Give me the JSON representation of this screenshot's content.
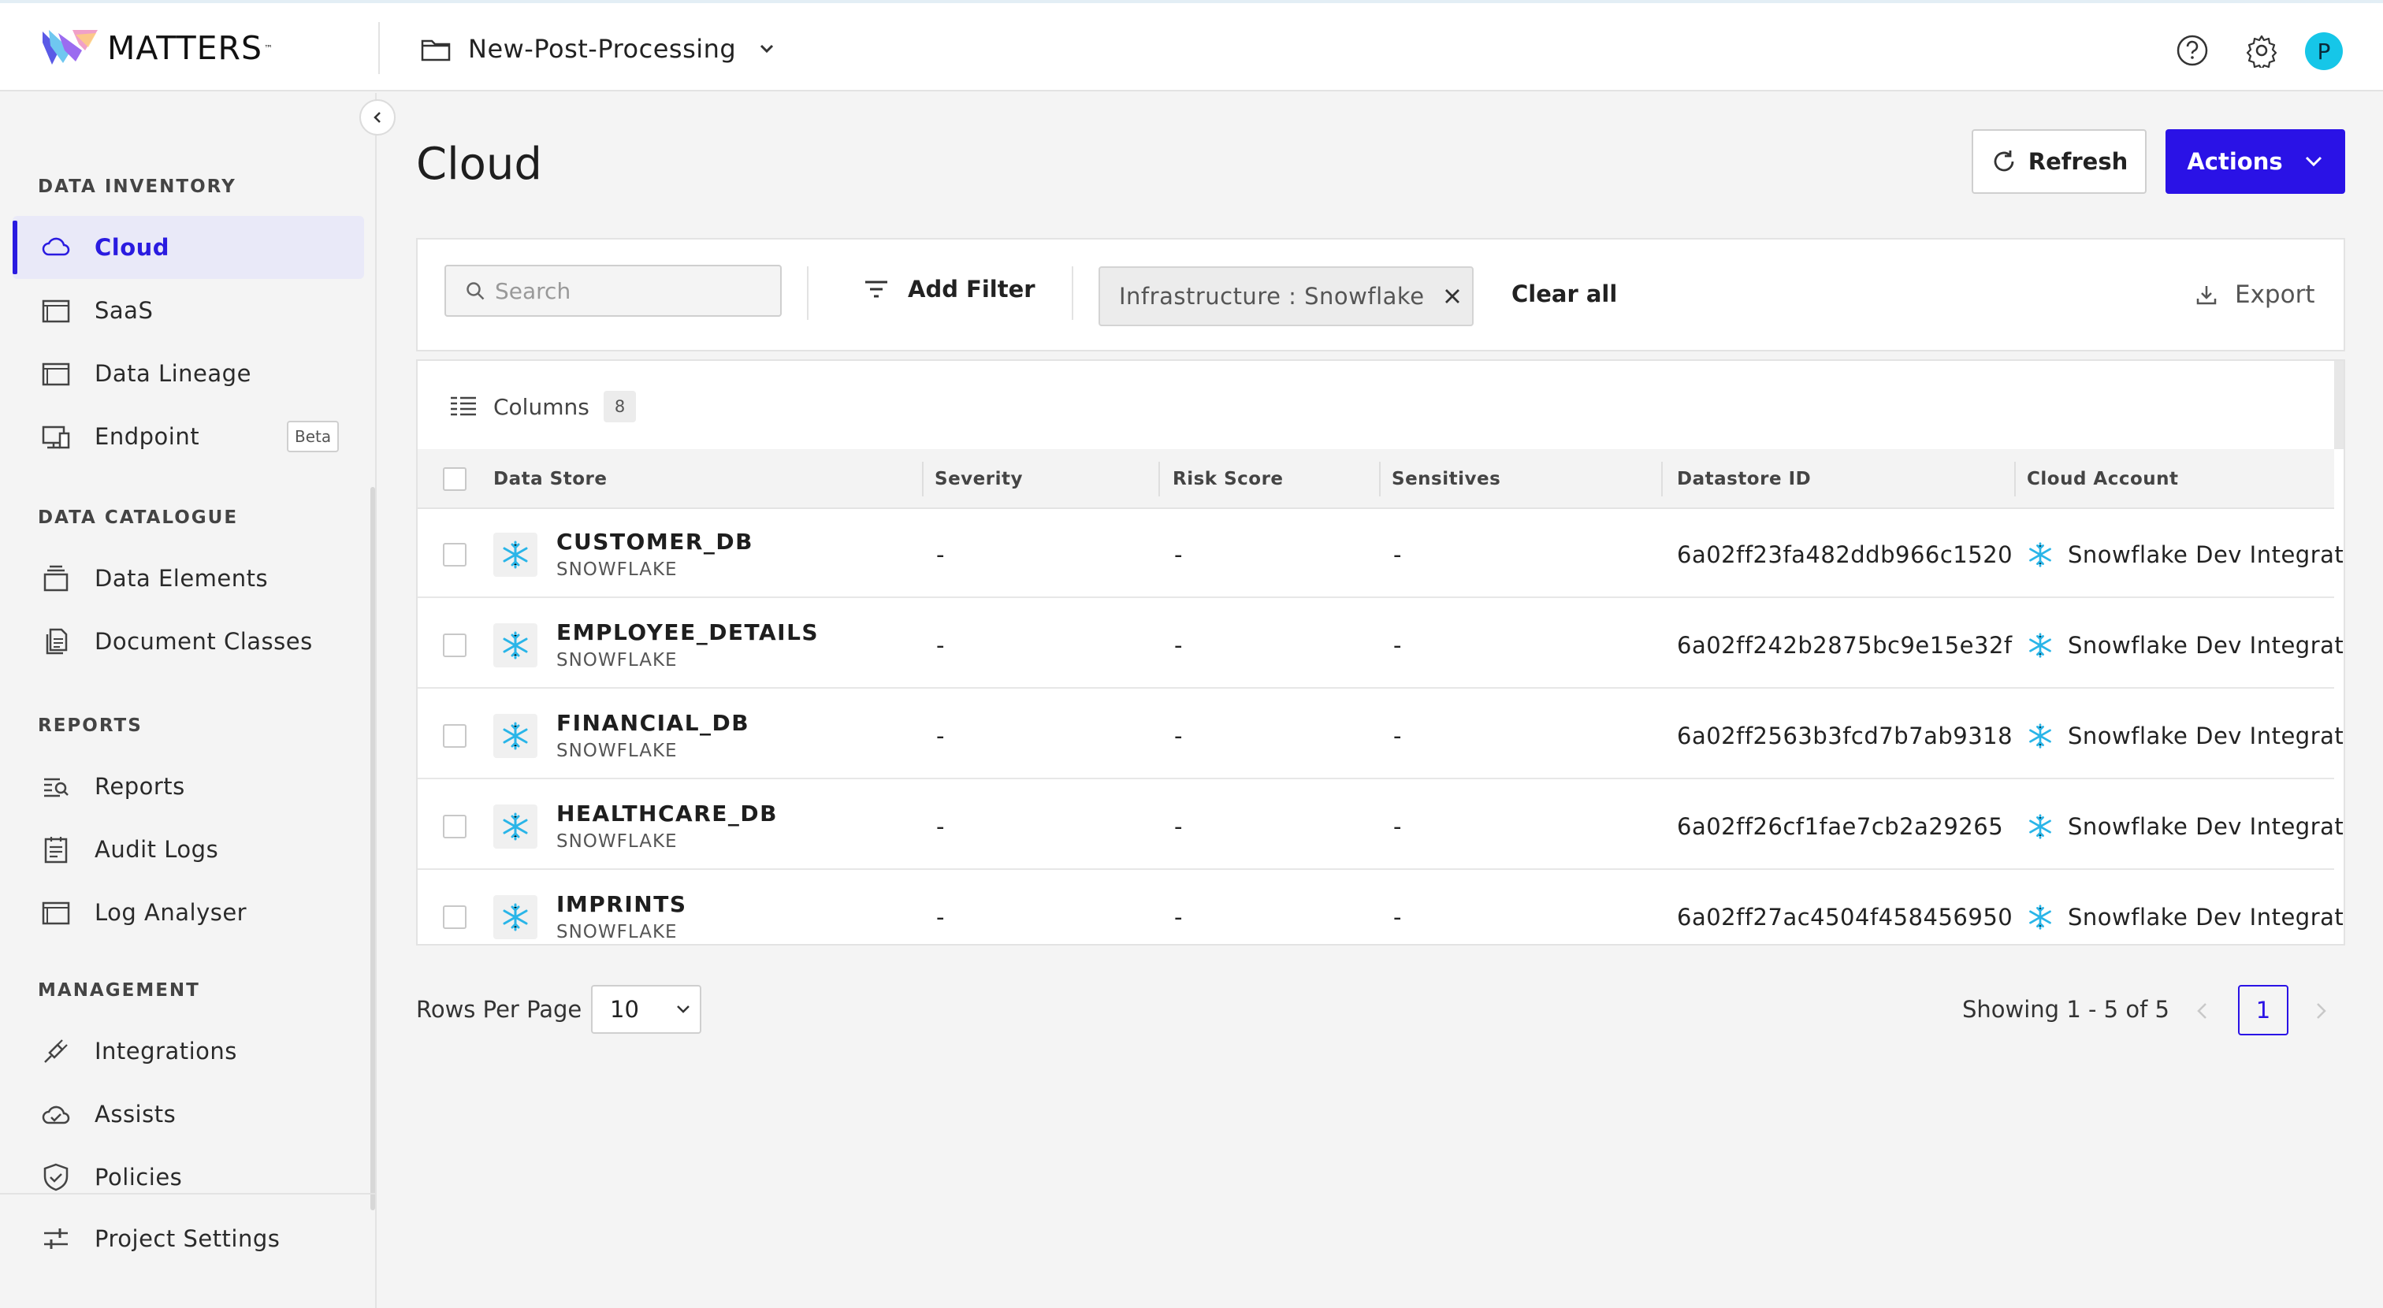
{
  "header": {
    "brand": "MATTERS",
    "brand_tm": "™",
    "project_name": "New-Post-Processing",
    "avatar_initial": "P"
  },
  "sidebar": {
    "sections": [
      {
        "title": "DATA INVENTORY",
        "items": [
          {
            "label": "Cloud",
            "icon": "cloud-icon",
            "active": true
          },
          {
            "label": "SaaS",
            "icon": "window-icon"
          },
          {
            "label": "Data Lineage",
            "icon": "window-icon"
          },
          {
            "label": "Endpoint",
            "icon": "devices-icon",
            "badge": "Beta"
          }
        ]
      },
      {
        "title": "DATA CATALOGUE",
        "items": [
          {
            "label": "Data Elements",
            "icon": "stack-icon"
          },
          {
            "label": "Document Classes",
            "icon": "documents-icon"
          }
        ]
      },
      {
        "title": "REPORTS",
        "items": [
          {
            "label": "Reports",
            "icon": "report-search-icon"
          },
          {
            "label": "Audit Logs",
            "icon": "clipboard-icon"
          },
          {
            "label": "Log Analyser",
            "icon": "window-icon"
          }
        ]
      },
      {
        "title": "MANAGEMENT",
        "items": [
          {
            "label": "Integrations",
            "icon": "plug-icon"
          },
          {
            "label": "Assists",
            "icon": "cloud-check-icon"
          },
          {
            "label": "Policies",
            "icon": "shield-check-icon"
          }
        ]
      }
    ],
    "footer_item": {
      "label": "Project Settings",
      "icon": "sliders-icon"
    }
  },
  "main": {
    "title": "Cloud",
    "refresh_label": "Refresh",
    "actions_label": "Actions",
    "search_placeholder": "Search",
    "add_filter_label": "Add Filter",
    "filter_chip": "Infrastructure : Snowflake",
    "clear_all_label": "Clear all",
    "export_label": "Export",
    "columns_label": "Columns",
    "columns_count": "8",
    "table": {
      "headers": [
        "Data Store",
        "Severity",
        "Risk Score",
        "Sensitives",
        "Datastore ID",
        "Cloud Account"
      ],
      "rows": [
        {
          "name": "CUSTOMER_DB",
          "type": "SNOWFLAKE",
          "severity": "-",
          "risk": "-",
          "sensitives": "-",
          "id": "6a02ff23fa482ddb966c1520",
          "account": "Snowflake Dev Integration"
        },
        {
          "name": "EMPLOYEE_DETAILS",
          "type": "SNOWFLAKE",
          "severity": "-",
          "risk": "-",
          "sensitives": "-",
          "id": "6a02ff242b2875bc9e15e32f",
          "account": "Snowflake Dev Integration"
        },
        {
          "name": "FINANCIAL_DB",
          "type": "SNOWFLAKE",
          "severity": "-",
          "risk": "-",
          "sensitives": "-",
          "id": "6a02ff2563b3fcd7b7ab9318",
          "account": "Snowflake Dev Integration"
        },
        {
          "name": "HEALTHCARE_DB",
          "type": "SNOWFLAKE",
          "severity": "-",
          "risk": "-",
          "sensitives": "-",
          "id": "6a02ff26cf1fae7cb2a29265",
          "account": "Snowflake Dev Integration"
        },
        {
          "name": "IMPRINTS",
          "type": "SNOWFLAKE",
          "severity": "-",
          "risk": "-",
          "sensitives": "-",
          "id": "6a02ff27ac4504f458456950",
          "account": "Snowflake Dev Integration"
        }
      ]
    },
    "pagination": {
      "rows_per_page_label": "Rows Per Page",
      "rows_per_page_value": "10",
      "showing": "Showing 1 - 5 of 5",
      "current_page": "1"
    }
  },
  "colors": {
    "accent": "#2a12e6",
    "snowflake": "#29b5e8",
    "avatar": "#16c6e8"
  }
}
